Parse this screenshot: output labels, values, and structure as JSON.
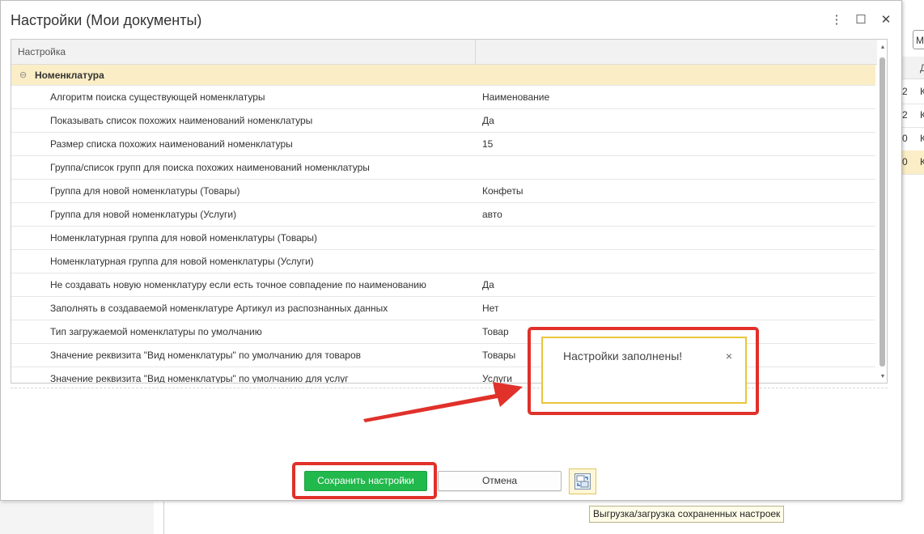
{
  "background_app": {
    "input_value": "М",
    "header_letter": "Д",
    "rows": [
      {
        "num": "2",
        "letter": "К"
      },
      {
        "num": "2",
        "letter": "К"
      },
      {
        "num": "0",
        "letter": "К"
      },
      {
        "num": "0",
        "letter": "К"
      }
    ]
  },
  "dialog": {
    "title": "Настройки (Мои документы)",
    "controls": {
      "more": "⋮",
      "maximize": "☐",
      "close": "✕"
    }
  },
  "grid": {
    "headers": [
      "Настройка",
      ""
    ],
    "group": {
      "toggle": "⊖",
      "label": "Номенклатура"
    },
    "rows": [
      {
        "name": "Алгоритм поиска существующей номенклатуры",
        "value": "Наименование"
      },
      {
        "name": "Показывать список похожих наименований номенклатуры",
        "value": "Да"
      },
      {
        "name": "Размер списка похожих наименований номенклатуры",
        "value": "15"
      },
      {
        "name": "Группа/список групп для поиска похожих наименований номенклатуры",
        "value": ""
      },
      {
        "name": "Группа для новой номенклатуры (Товары)",
        "value": "Конфеты"
      },
      {
        "name": "Группа для новой номенклатуры (Услуги)",
        "value": "авто"
      },
      {
        "name": "Номенклатурная группа для новой номенклатуры (Товары)",
        "value": ""
      },
      {
        "name": "Номенклатурная группа для новой номенклатуры (Услуги)",
        "value": ""
      },
      {
        "name": "Не создавать новую номенклатуру если есть точное совпадение по наименованию",
        "value": "Да"
      },
      {
        "name": "Заполнять в создаваемой номенклатуре Артикул из распознанных данных",
        "value": "Нет"
      },
      {
        "name": "Тип загружаемой номенклатуры по умолчанию",
        "value": "Товар"
      },
      {
        "name": "Значение реквизита \"Вид номенклатуры\" по умолчанию для товаров",
        "value": "Товары"
      },
      {
        "name": "Значение реквизита \"Вид номенклатуры\" по умолчанию для услуг",
        "value": "Услуги"
      }
    ]
  },
  "notification": {
    "text": "Настройки заполнены!",
    "close": "×"
  },
  "buttons": {
    "save": "Сохранить настройки",
    "cancel": "Отмена",
    "io_tooltip": "Выгрузка/загрузка сохраненных настроек"
  },
  "colors": {
    "save_green": "#21b84c",
    "group_row": "#fbeec6",
    "annotation_red": "#e0312a",
    "notification_border": "#e8c63a"
  }
}
